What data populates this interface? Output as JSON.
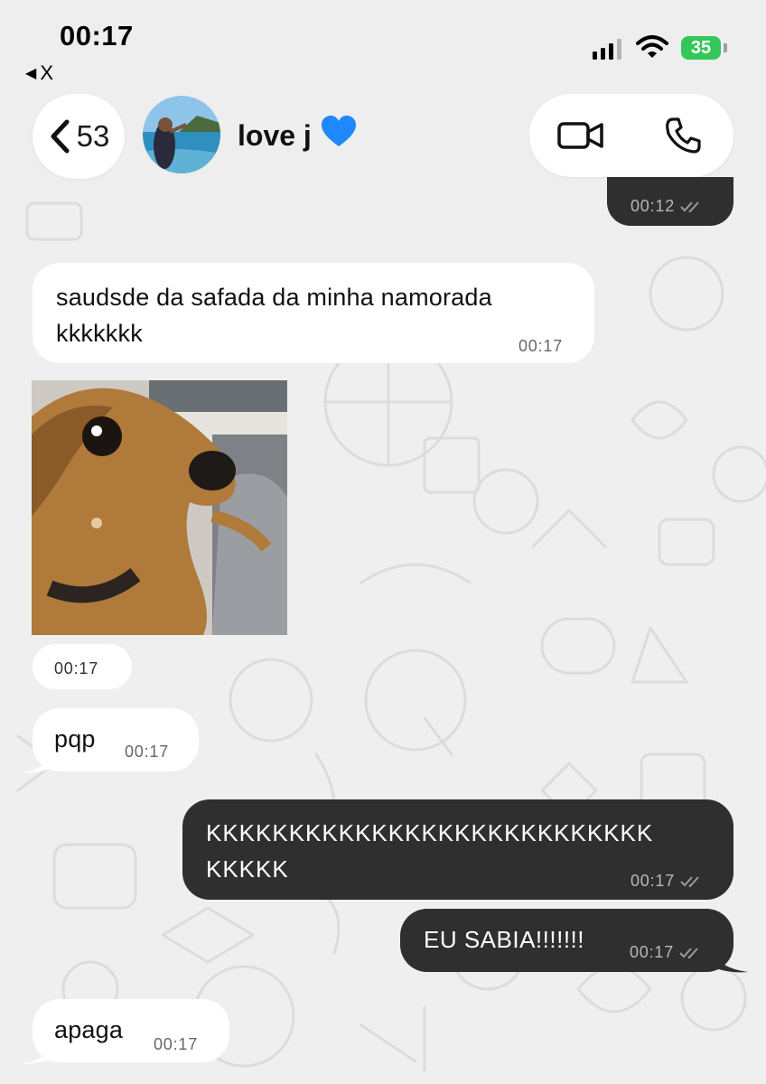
{
  "status_bar": {
    "time": "00:17",
    "back_app_label": "X",
    "battery": "35"
  },
  "header": {
    "back_count": "53",
    "contact_name": "love j",
    "contact_emoji": "💙"
  },
  "messages": [
    {
      "direction": "out",
      "text": "",
      "time": "00:12"
    },
    {
      "direction": "in",
      "text_line1": "saudsde da safada da minha namorada",
      "text_line2": "kkkkkkk",
      "time": "00:17"
    },
    {
      "direction": "in",
      "type": "image",
      "image_subject": "dachshund dog side-eye",
      "time": "00:17"
    },
    {
      "direction": "in",
      "text": "pqp",
      "time": "00:17"
    },
    {
      "direction": "out",
      "text_line1": "KKKKKKKKKKKKKKKKKKKKKKKKKKK",
      "text_line2": "KKKKK",
      "time": "00:17"
    },
    {
      "direction": "out",
      "text": "EU SABIA!!!!!!!",
      "time": "00:17"
    },
    {
      "direction": "in",
      "text": "apaga",
      "time": "00:17"
    }
  ],
  "colors": {
    "background": "#efefef",
    "incoming_bubble": "#ffffff",
    "outgoing_bubble": "#2f2f2f",
    "battery": "#34c759",
    "heart": "#1e88ff"
  },
  "icons": {
    "back": "chevron-left-icon",
    "video": "video-camera-icon",
    "call": "phone-icon",
    "read_receipt": "double-check-icon"
  }
}
